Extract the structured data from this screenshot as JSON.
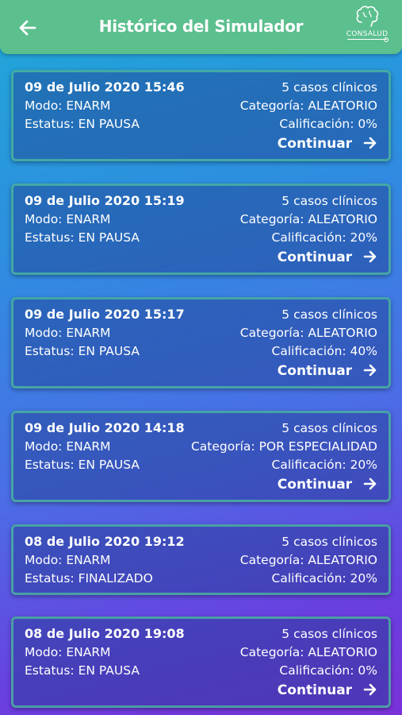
{
  "header": {
    "title": "Histórico del Simulador",
    "logo_text": "CONSALUD"
  },
  "cards": [
    {
      "date": "09 de Julio 2020 15:46",
      "cases": "5 casos clínicos",
      "mode": "Modo: ENARM",
      "category": "Categoría: ALEATORIO",
      "status": "Estatus: EN PAUSA",
      "grade": "Calificación: 0%",
      "continue_label": "Continuar"
    },
    {
      "date": "09 de Julio 2020 15:19",
      "cases": "5 casos clínicos",
      "mode": "Modo: ENARM",
      "category": "Categoría: ALEATORIO",
      "status": "Estatus: EN PAUSA",
      "grade": "Calificación: 20%",
      "continue_label": "Continuar"
    },
    {
      "date": "09 de Julio 2020 15:17",
      "cases": "5 casos clínicos",
      "mode": "Modo: ENARM",
      "category": "Categoría: ALEATORIO",
      "status": "Estatus: EN PAUSA",
      "grade": "Calificación: 40%",
      "continue_label": "Continuar"
    },
    {
      "date": "09 de Julio 2020 14:18",
      "cases": "5 casos clínicos",
      "mode": "Modo: ENARM",
      "category": "Categoría: POR ESPECIALIDAD",
      "status": "Estatus: EN PAUSA",
      "grade": "Calificación: 20%",
      "continue_label": "Continuar"
    },
    {
      "date": "08 de Julio 2020 19:12",
      "cases": "5 casos clínicos",
      "mode": "Modo: ENARM",
      "category": "Categoría: ALEATORIO",
      "status": "Estatus: FINALIZADO",
      "grade": "Calificación: 20%"
    },
    {
      "date": "08 de Julio 2020 19:08",
      "cases": "5 casos clínicos",
      "mode": "Modo: ENARM",
      "category": "Categoría: ALEATORIO",
      "status": "Estatus: EN PAUSA",
      "grade": "Calificación: 0%",
      "continue_label": "Continuar"
    }
  ],
  "colors": {
    "header_bg": "#5bbf8e",
    "card_border": "#4ebea0",
    "text": "#ffffff"
  },
  "icons": {
    "back": "arrow-left-icon",
    "logo": "brain-logo-icon",
    "continue": "arrow-right-icon"
  }
}
